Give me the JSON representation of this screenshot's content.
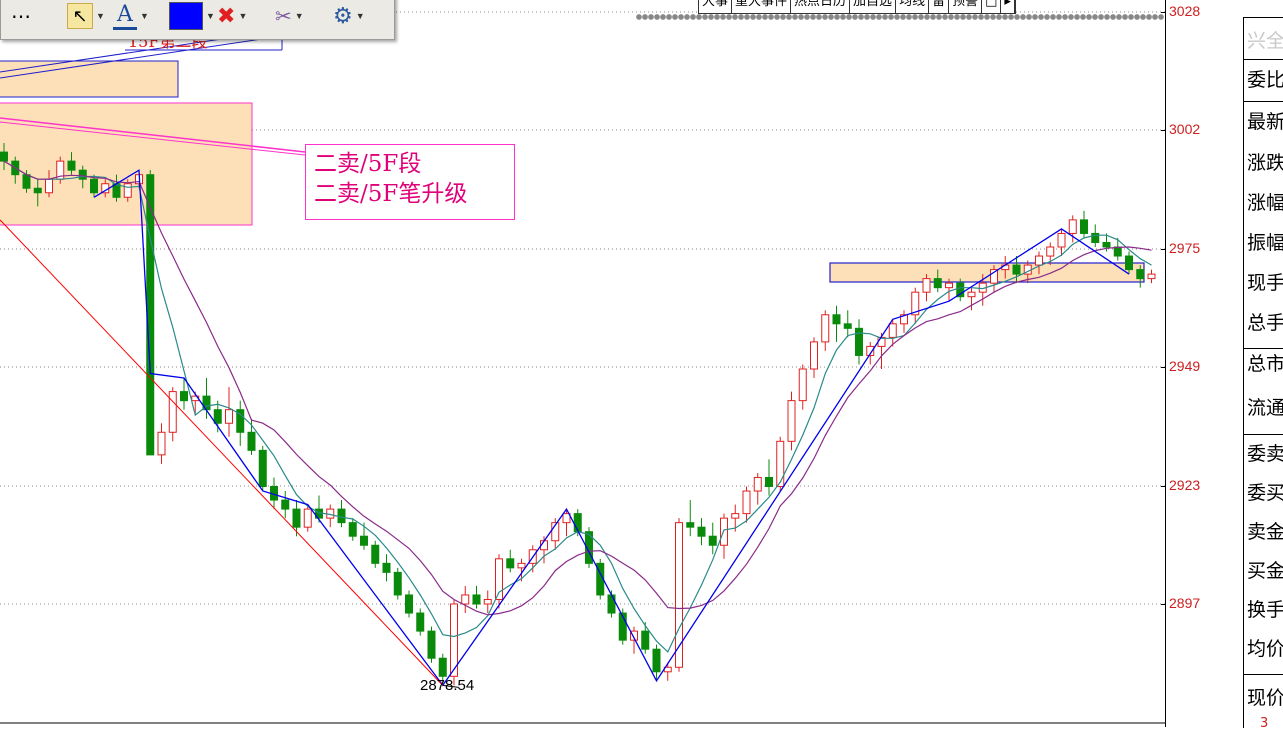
{
  "colors": {
    "up": "#e02020",
    "down": "#0a8a0a",
    "ma_fast": "#2a8a8a",
    "ma_slow": "#8a2a8a",
    "stroke_line": "#0000ee",
    "trend_line": "#ff0000",
    "zone_fill": "#fde0b8",
    "annotation": "#ff33cc",
    "axis_text": "#cc2020"
  },
  "toolbar": {
    "items": [
      {
        "icon": "more-icon",
        "glyph": "⋯"
      },
      {
        "icon": "cursor-icon",
        "glyph": "↖"
      },
      {
        "icon": "text-tool-icon",
        "glyph": "A"
      },
      {
        "icon": "color-swatch-icon",
        "glyph": ""
      },
      {
        "icon": "delete-icon",
        "glyph": "✖"
      },
      {
        "icon": "clear-drawings-icon",
        "glyph": "✂"
      },
      {
        "icon": "settings-icon",
        "glyph": "⚙"
      }
    ]
  },
  "top_tabs": [
    "大事",
    "重大事件",
    "热点日历",
    "加自选",
    "均线",
    "留",
    "预警",
    "□",
    "▸"
  ],
  "price_axis": {
    "labels": [
      "3028",
      "3002",
      "2975",
      "2949",
      "2923",
      "2897"
    ]
  },
  "annotation": {
    "line1": "二卖/5F段",
    "line2": "二卖/5F笔升级"
  },
  "low_marker": "2878.54",
  "top_left_fragment": "15F第二段",
  "info_panel": {
    "title": "兴全",
    "rows": [
      "委比",
      "最新",
      "涨跌",
      "涨幅",
      "振幅",
      "现手",
      "总手",
      "总市",
      "流通",
      "委卖",
      "委买",
      "卖金",
      "买金",
      "换手",
      "均价",
      "现价"
    ],
    "bottom_fragment": "3"
  },
  "chart_data": {
    "type": "candlestick",
    "title": "",
    "y_ticks": [
      3028,
      3002,
      2975,
      2949,
      2923,
      2897
    ],
    "ylim": [
      2870,
      3030
    ],
    "low_label_value": 2878.54,
    "candles": [
      [
        2997,
        2999,
        2993,
        2995
      ],
      [
        2995,
        2996,
        2990,
        2992
      ],
      [
        2992,
        2993,
        2988,
        2989
      ],
      [
        2989,
        2991,
        2985,
        2988
      ],
      [
        2988,
        2993,
        2987,
        2991
      ],
      [
        2991,
        2996,
        2990,
        2995
      ],
      [
        2995,
        2997,
        2992,
        2993
      ],
      [
        2993,
        2994,
        2989,
        2991
      ],
      [
        2991,
        2992,
        2987,
        2988
      ],
      [
        2988,
        2991,
        2987,
        2990
      ],
      [
        2990,
        2992,
        2986,
        2987
      ],
      [
        2987,
        2991,
        2986,
        2990
      ],
      [
        2990,
        2993,
        2989,
        2992
      ],
      [
        2992,
        2993,
        2948,
        2930
      ],
      [
        2930,
        2937,
        2928,
        2935
      ],
      [
        2935,
        2945,
        2933,
        2944
      ],
      [
        2944,
        2947,
        2940,
        2942
      ],
      [
        2942,
        2944,
        2939,
        2943
      ],
      [
        2943,
        2947,
        2938,
        2940
      ],
      [
        2940,
        2942,
        2935,
        2937
      ],
      [
        2937,
        2945,
        2934,
        2940
      ],
      [
        2940,
        2942,
        2932,
        2935
      ],
      [
        2935,
        2938,
        2930,
        2931
      ],
      [
        2931,
        2932,
        2922,
        2923
      ],
      [
        2923,
        2925,
        2918,
        2920
      ],
      [
        2920,
        2922,
        2916,
        2918
      ],
      [
        2918,
        2920,
        2912,
        2914
      ],
      [
        2914,
        2919,
        2913,
        2918
      ],
      [
        2918,
        2921,
        2915,
        2916
      ],
      [
        2916,
        2919,
        2914,
        2918
      ],
      [
        2918,
        2920,
        2914,
        2915
      ],
      [
        2915,
        2916,
        2911,
        2912
      ],
      [
        2912,
        2915,
        2909,
        2910
      ],
      [
        2910,
        2911,
        2905,
        2906
      ],
      [
        2906,
        2908,
        2902,
        2904
      ],
      [
        2904,
        2905,
        2898,
        2899
      ],
      [
        2899,
        2900,
        2894,
        2895
      ],
      [
        2895,
        2896,
        2890,
        2891
      ],
      [
        2891,
        2892,
        2884,
        2885
      ],
      [
        2885,
        2886,
        2879,
        2881
      ],
      [
        2881,
        2898,
        2879,
        2897
      ],
      [
        2897,
        2901,
        2895,
        2899
      ],
      [
        2899,
        2901,
        2896,
        2897
      ],
      [
        2897,
        2900,
        2895,
        2898
      ],
      [
        2898,
        2908,
        2896,
        2907
      ],
      [
        2907,
        2909,
        2904,
        2905
      ],
      [
        2905,
        2907,
        2902,
        2906
      ],
      [
        2906,
        2910,
        2904,
        2909
      ],
      [
        2909,
        2912,
        2906,
        2911
      ],
      [
        2911,
        2916,
        2909,
        2915
      ],
      [
        2915,
        2918,
        2912,
        2917
      ],
      [
        2917,
        2918,
        2912,
        2913
      ],
      [
        2913,
        2914,
        2905,
        2906
      ],
      [
        2906,
        2907,
        2898,
        2899
      ],
      [
        2899,
        2900,
        2894,
        2895
      ],
      [
        2895,
        2896,
        2888,
        2889
      ],
      [
        2889,
        2892,
        2886,
        2891
      ],
      [
        2891,
        2893,
        2886,
        2887
      ],
      [
        2887,
        2888,
        2880,
        2882
      ],
      [
        2882,
        2884,
        2880,
        2883
      ],
      [
        2883,
        2916,
        2882,
        2915
      ],
      [
        2915,
        2920,
        2912,
        2914
      ],
      [
        2914,
        2916,
        2910,
        2912
      ],
      [
        2912,
        2915,
        2908,
        2910
      ],
      [
        2910,
        2917,
        2907,
        2916
      ],
      [
        2916,
        2919,
        2913,
        2917
      ],
      [
        2917,
        2923,
        2915,
        2922
      ],
      [
        2922,
        2926,
        2919,
        2925
      ],
      [
        2925,
        2929,
        2921,
        2923
      ],
      [
        2923,
        2934,
        2922,
        2933
      ],
      [
        2933,
        2944,
        2931,
        2942
      ],
      [
        2942,
        2950,
        2940,
        2949
      ],
      [
        2949,
        2956,
        2947,
        2955
      ],
      [
        2955,
        2962,
        2953,
        2961
      ],
      [
        2961,
        2963,
        2955,
        2959
      ],
      [
        2959,
        2962,
        2956,
        2958
      ],
      [
        2958,
        2960,
        2950,
        2952
      ],
      [
        2952,
        2955,
        2950,
        2954
      ],
      [
        2954,
        2957,
        2949,
        2956
      ],
      [
        2956,
        2960,
        2954,
        2959
      ],
      [
        2959,
        2962,
        2957,
        2961
      ],
      [
        2961,
        2967,
        2959,
        2966
      ],
      [
        2966,
        2970,
        2964,
        2969
      ],
      [
        2969,
        2971,
        2966,
        2967
      ],
      [
        2967,
        2969,
        2964,
        2968
      ],
      [
        2968,
        2969,
        2964,
        2965
      ],
      [
        2965,
        2967,
        2962,
        2966
      ],
      [
        2966,
        2970,
        2963,
        2968
      ],
      [
        2968,
        2972,
        2966,
        2971
      ],
      [
        2971,
        2974,
        2969,
        2972
      ],
      [
        2972,
        2974,
        2968,
        2970
      ],
      [
        2970,
        2973,
        2968,
        2972
      ],
      [
        2972,
        2975,
        2970,
        2974
      ],
      [
        2974,
        2977,
        2972,
        2976
      ],
      [
        2976,
        2980,
        2974,
        2979
      ],
      [
        2979,
        2983,
        2977,
        2982
      ],
      [
        2982,
        2984,
        2978,
        2979
      ],
      [
        2979,
        2981,
        2976,
        2977
      ],
      [
        2977,
        2979,
        2975,
        2976
      ],
      [
        2976,
        2978,
        2973,
        2974
      ],
      [
        2974,
        2975,
        2970,
        2971
      ],
      [
        2971,
        2972,
        2967,
        2969
      ],
      [
        2969,
        2971,
        2968,
        2970
      ]
    ]
  }
}
